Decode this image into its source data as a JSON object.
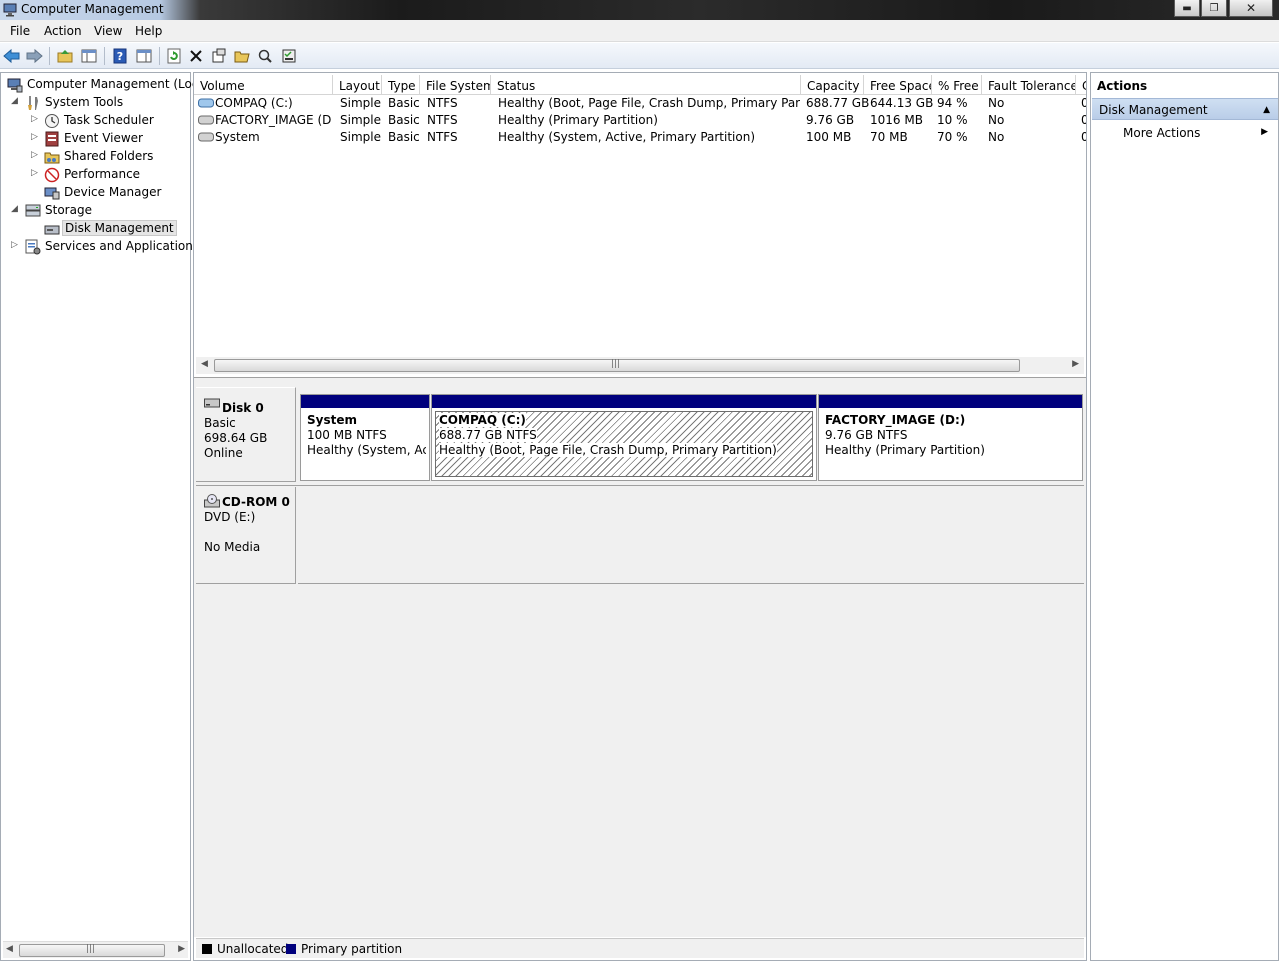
{
  "window": {
    "title": "Computer Management"
  },
  "menu": [
    "File",
    "Action",
    "View",
    "Help"
  ],
  "tree": {
    "root": "Computer Management (Local",
    "items": [
      {
        "label": "System Tools"
      },
      {
        "label": "Task Scheduler"
      },
      {
        "label": "Event Viewer"
      },
      {
        "label": "Shared Folders"
      },
      {
        "label": "Performance"
      },
      {
        "label": "Device Manager"
      },
      {
        "label": "Storage"
      },
      {
        "label": "Disk Management"
      },
      {
        "label": "Services and Applications"
      }
    ]
  },
  "volumes": {
    "columns": [
      "Volume",
      "Layout",
      "Type",
      "File System",
      "Status",
      "Capacity",
      "Free Space",
      "% Free",
      "Fault Tolerance",
      "C"
    ],
    "rows": [
      {
        "volume": "COMPAQ (C:)",
        "layout": "Simple",
        "type": "Basic",
        "fs": "NTFS",
        "status": "Healthy (Boot, Page File, Crash Dump, Primary Partition)",
        "capacity": "688.77 GB",
        "free": "644.13 GB",
        "pct": "94 %",
        "fault": "No",
        "overhead": "0"
      },
      {
        "volume": "FACTORY_IMAGE (D:)",
        "layout": "Simple",
        "type": "Basic",
        "fs": "NTFS",
        "status": "Healthy (Primary Partition)",
        "capacity": "9.76 GB",
        "free": "1016 MB",
        "pct": "10 %",
        "fault": "No",
        "overhead": "0"
      },
      {
        "volume": "System",
        "layout": "Simple",
        "type": "Basic",
        "fs": "NTFS",
        "status": "Healthy (System, Active, Primary Partition)",
        "capacity": "100 MB",
        "free": "70 MB",
        "pct": "70 %",
        "fault": "No",
        "overhead": "0"
      }
    ]
  },
  "disks": [
    {
      "name": "Disk 0",
      "kind": "Basic",
      "size": "698.64 GB",
      "state": "Online",
      "partitions": [
        {
          "name": "System",
          "size": "100 MB NTFS",
          "status": "Healthy (System, Activ"
        },
        {
          "name": "COMPAQ  (C:)",
          "size": "688.77 GB NTFS",
          "status": "Healthy (Boot, Page File, Crash Dump, Primary Partition)"
        },
        {
          "name": "FACTORY_IMAGE  (D:)",
          "size": "9.76 GB NTFS",
          "status": "Healthy (Primary Partition)"
        }
      ]
    },
    {
      "name": "CD-ROM 0",
      "kind": "DVD (E:)",
      "state": "No Media"
    }
  ],
  "legend": [
    {
      "label": "Unallocated",
      "color": "#000000"
    },
    {
      "label": "Primary partition",
      "color": "#00007d"
    }
  ],
  "actions": {
    "title": "Actions",
    "group": "Disk Management",
    "more": "More Actions"
  },
  "colors": {
    "primary_partition": "#00007d",
    "selection": "#b9cde8"
  }
}
